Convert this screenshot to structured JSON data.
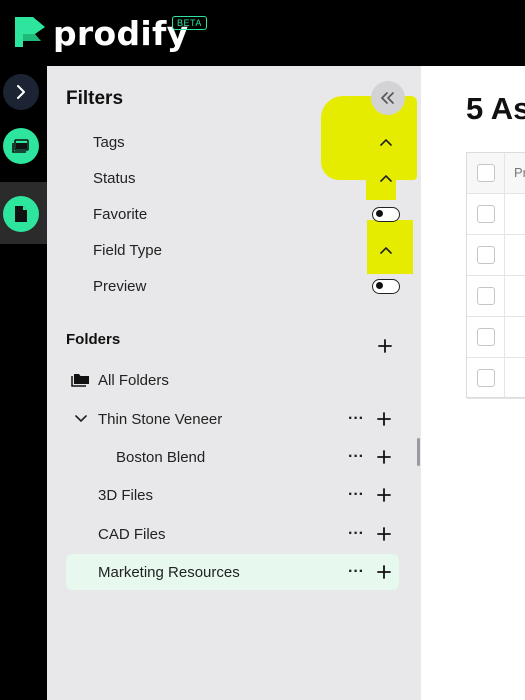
{
  "app": {
    "name": "prodify",
    "badge": "BETA",
    "brand_color": "#2ee59d"
  },
  "rail": {
    "items": [
      {
        "icon": "chevron-right-icon"
      },
      {
        "icon": "folder-stack-icon"
      },
      {
        "icon": "document-icon",
        "active": true
      }
    ]
  },
  "filters": {
    "title": "Filters",
    "collapse_icon": "double-chevron-left-icon",
    "items": [
      {
        "label": "Tags",
        "control": "chevron-up"
      },
      {
        "label": "Status",
        "control": "chevron-up"
      },
      {
        "label": "Favorite",
        "control": "toggle",
        "value": false
      },
      {
        "label": "Field Type",
        "control": "chevron-up"
      },
      {
        "label": "Preview",
        "control": "toggle",
        "value": false
      }
    ],
    "highlight_color": "#e6ec00"
  },
  "folders": {
    "title": "Folders",
    "all_label": "All Folders",
    "items": [
      {
        "label": "Thin Stone Veneer",
        "expanded": true
      },
      {
        "label": "Boston Blend"
      },
      {
        "label": "3D Files"
      },
      {
        "label": "CAD Files"
      },
      {
        "label": "Marketing Resources",
        "selected": true
      }
    ]
  },
  "main": {
    "title": "5 As",
    "table": {
      "header_cell": "Pr",
      "row_count": 5
    }
  }
}
